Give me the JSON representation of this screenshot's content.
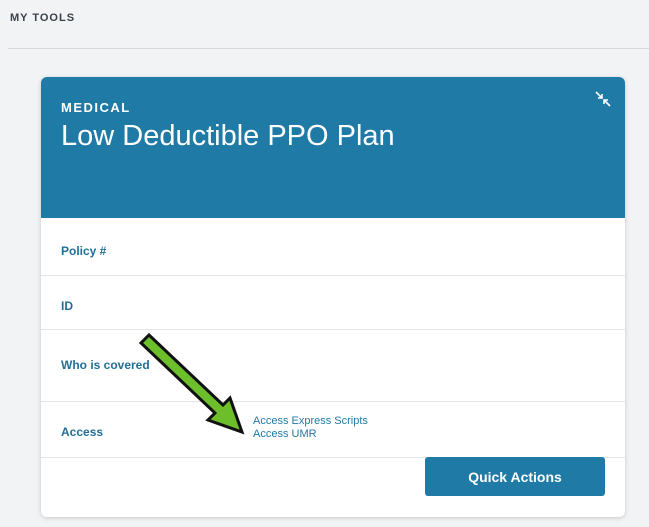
{
  "section": {
    "title": "MY TOOLS"
  },
  "card": {
    "category": "MEDICAL",
    "title": "Low Deductible PPO Plan",
    "collapse_icon": "collapse-arrows-icon",
    "rows": {
      "policy_label": "Policy #",
      "id_label": "ID",
      "covered_label": "Who is covered",
      "access_label": "Access"
    },
    "access_links": [
      "Access Express Scripts",
      "Access UMR"
    ],
    "quick_actions_label": "Quick Actions"
  },
  "annotation": {
    "icon": "green-arrow-icon",
    "color": "#6cbf2a"
  },
  "colors": {
    "brand": "#1f7aa6",
    "label": "#1f6f98",
    "background": "#f1f3f5"
  }
}
